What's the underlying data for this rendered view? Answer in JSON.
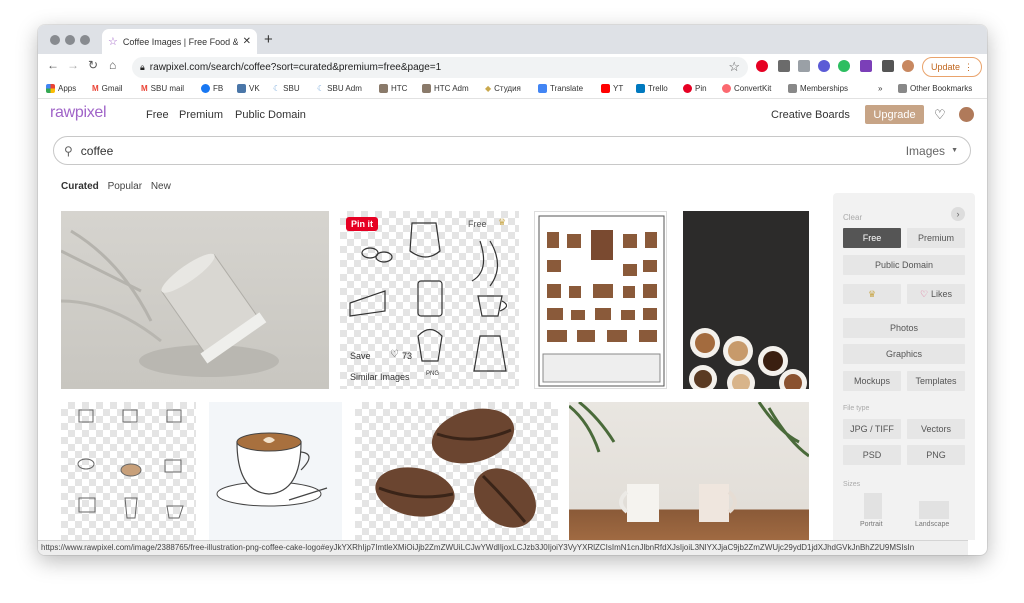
{
  "browser": {
    "tab_title": "Coffee Images | Free Food & B",
    "url": "rawpixel.com/search/coffee?sort=curated&premium=free&page=1",
    "update_label": "Update",
    "bookmarks": [
      "Apps",
      "Gmail",
      "SBU mail",
      "FB",
      "VK",
      "SBU",
      "SBU Adm",
      "HTC",
      "HTC Adm",
      "Студия",
      "Translate",
      "YT",
      "Trello",
      "Pin",
      "ConvertKit",
      "Memberships"
    ],
    "other_bookmarks": "Other Bookmarks",
    "overflow": "»"
  },
  "site": {
    "logo": "rawpixel",
    "nav": [
      "Free",
      "Premium",
      "Public Domain"
    ],
    "creative_boards": "Creative Boards",
    "upgrade": "Upgrade"
  },
  "search": {
    "value": "coffee",
    "scope": "Images"
  },
  "sort_tabs": [
    "Curated",
    "Popular",
    "New"
  ],
  "overlay": {
    "pin": "Pin it",
    "free": "Free",
    "save": "Save",
    "likes": "73",
    "similar": "Similar Images",
    "png": "PNG"
  },
  "filters": {
    "clear": "Clear",
    "license": [
      "Free",
      "Premium",
      "Public Domain"
    ],
    "likes": "Likes",
    "types": [
      "Photos",
      "Graphics",
      "Mockups",
      "Templates"
    ],
    "file_type_label": "File type",
    "file_types": [
      "JPG / TIFF",
      "Vectors",
      "PSD",
      "PNG"
    ],
    "sizes_label": "Sizes",
    "sizes": [
      "Portrait",
      "Landscape"
    ]
  },
  "status_url": "https://www.rawpixel.com/image/2388765/free-illustration-png-coffee-cake-logo#eyJkYXRhIjp7ImtleXMiOiJjb2ZmZWUiLCJwYWdlIjoxLCJzb3J0IjoiY3VyYXRlZCIsImN1cnJlbnRfdXJsIjoiL3NlYXJjaC9jb2ZmZWUjc29ydD1jdXJhdGVkJnBhZ2U9MSIsIn",
  "colors": {
    "brand": "#a064c8",
    "upgrade": "#c7a486",
    "active_filter": "#555555",
    "pin": "#e60023"
  }
}
